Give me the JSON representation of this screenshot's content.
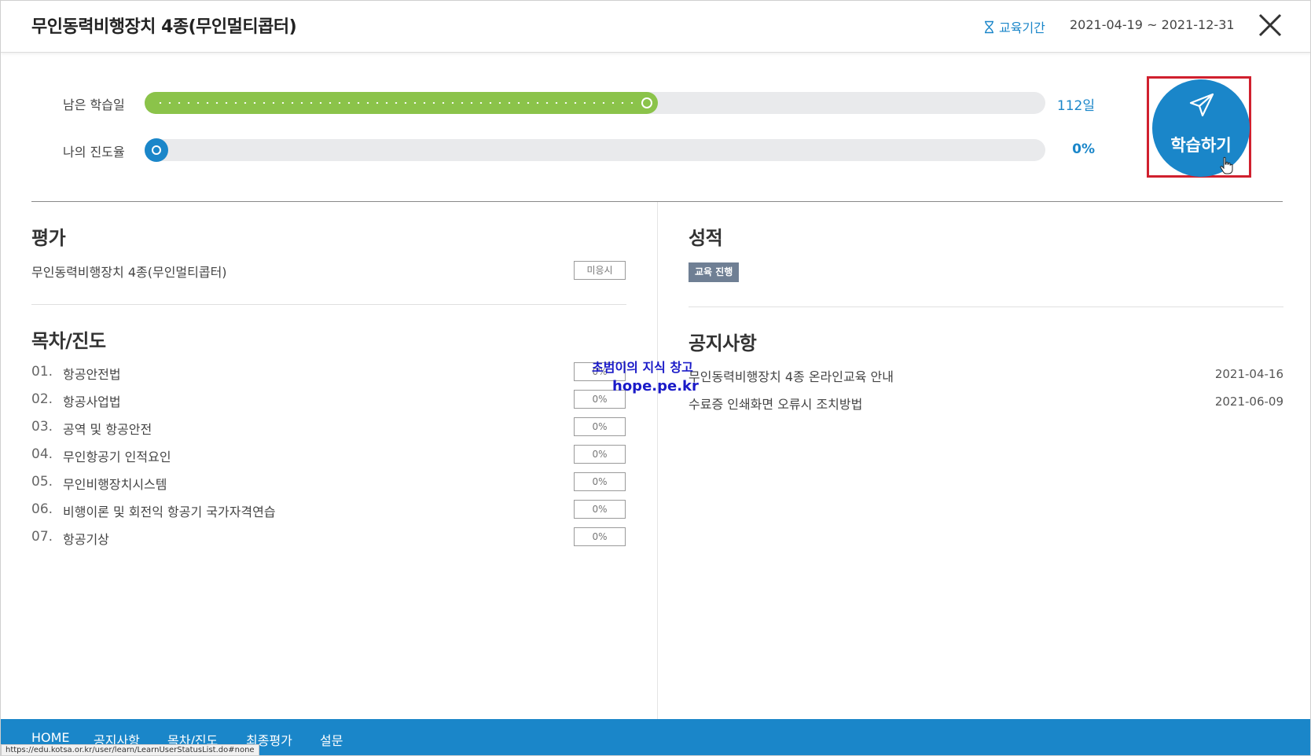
{
  "header": {
    "title": "무인동력비행장치 4종(무인멀티콥터)",
    "period_label": "교육기간",
    "period_value": "2021-04-19 ~ 2021-12-31",
    "close_icon": "close-icon",
    "hourglass_icon": "hourglass-icon"
  },
  "progress": {
    "days": {
      "label": "남은 학습일",
      "value": "112일",
      "fill_fraction": 0.57
    },
    "mine": {
      "label": "나의 진도율",
      "value": "0%",
      "fill_fraction": 0.0
    }
  },
  "learn_button": {
    "label": "학습하기",
    "icon": "paper-plane-icon"
  },
  "evaluation": {
    "title": "평가",
    "items": [
      {
        "name": "무인동력비행장치 4종(무인멀티콥터)",
        "status": "미응시"
      }
    ]
  },
  "toc": {
    "title": "목차/진도",
    "items": [
      {
        "num": "01.",
        "name": "항공안전법",
        "progress": "0%"
      },
      {
        "num": "02.",
        "name": "항공사업법",
        "progress": "0%"
      },
      {
        "num": "03.",
        "name": "공역 및 항공안전",
        "progress": "0%"
      },
      {
        "num": "04.",
        "name": "무인항공기 인적요인",
        "progress": "0%"
      },
      {
        "num": "05.",
        "name": "무인비행장치시스템",
        "progress": "0%"
      },
      {
        "num": "06.",
        "name": "비행이론 및 회전익 항공기 국가자격연습",
        "progress": "0%"
      },
      {
        "num": "07.",
        "name": "항공기상",
        "progress": "0%"
      }
    ]
  },
  "grade": {
    "title": "성적",
    "badge": "교육 진행"
  },
  "notices": {
    "title": "공지사항",
    "items": [
      {
        "title": "무인동력비행장치 4종 온라인교육 안내",
        "date": "2021-04-16"
      },
      {
        "title": "수료증 인쇄화면 오류시 조치방법",
        "date": "2021-06-09"
      }
    ]
  },
  "watermark": {
    "line1": "초범이의 지식 창고",
    "line2": "hope.pe.kr"
  },
  "bottom_nav": {
    "items": [
      "HOME",
      "공지사항",
      "목차/진도",
      "최종평가",
      "설문"
    ]
  },
  "status_url": "https://edu.kotsa.or.kr/user/learn/LearnUserStatusList.do#none",
  "colors": {
    "accent": "#1a86c9",
    "progress_green": "#8bc34a",
    "highlight_red": "#d0202e",
    "badge": "#6f7f94"
  }
}
